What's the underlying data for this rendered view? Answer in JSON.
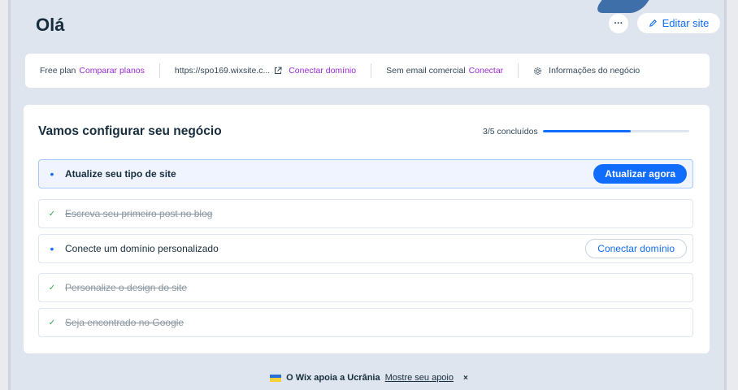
{
  "header": {
    "title": "Olá",
    "more_label": "···",
    "edit_label": "Editar site"
  },
  "info_bar": {
    "plan_text": "Free plan",
    "plan_link": "Comparar planos",
    "url_text": "https://spo169.wixsite.c...",
    "domain_link": "Conectar domínio",
    "email_text": "Sem email comercial",
    "email_link": "Conectar",
    "business_info": "Informações do negócio"
  },
  "setup": {
    "title": "Vamos configurar seu negócio",
    "progress_label": "3/5 concluídos",
    "progress_value": 0.6,
    "tasks": [
      {
        "label": "Atualize seu tipo de site",
        "done": false,
        "action": "Atualizar agora"
      },
      {
        "label": "Escreva seu primeiro post no blog",
        "done": true
      },
      {
        "label": "Conecte um domínio personalizado",
        "done": false,
        "action": "Conectar domínio"
      },
      {
        "label": "Personalize o design do site",
        "done": true
      },
      {
        "label": "Seja encontrado no Google",
        "done": true
      }
    ]
  },
  "banner": {
    "text": "O Wix apoia a Ucrânia",
    "link": "Mostre seu apoio",
    "close": "×"
  },
  "colors": {
    "accent": "#116dff",
    "link_purple": "#9b2bd6",
    "check_green": "#2fa84f",
    "background": "#dfe5ee"
  },
  "icons": {
    "edit": "pencil-icon",
    "external": "external-link-icon",
    "settings": "gear-icon",
    "done": "check-icon",
    "pending": "bullet-icon",
    "flag": "ukraine-flag-icon"
  }
}
